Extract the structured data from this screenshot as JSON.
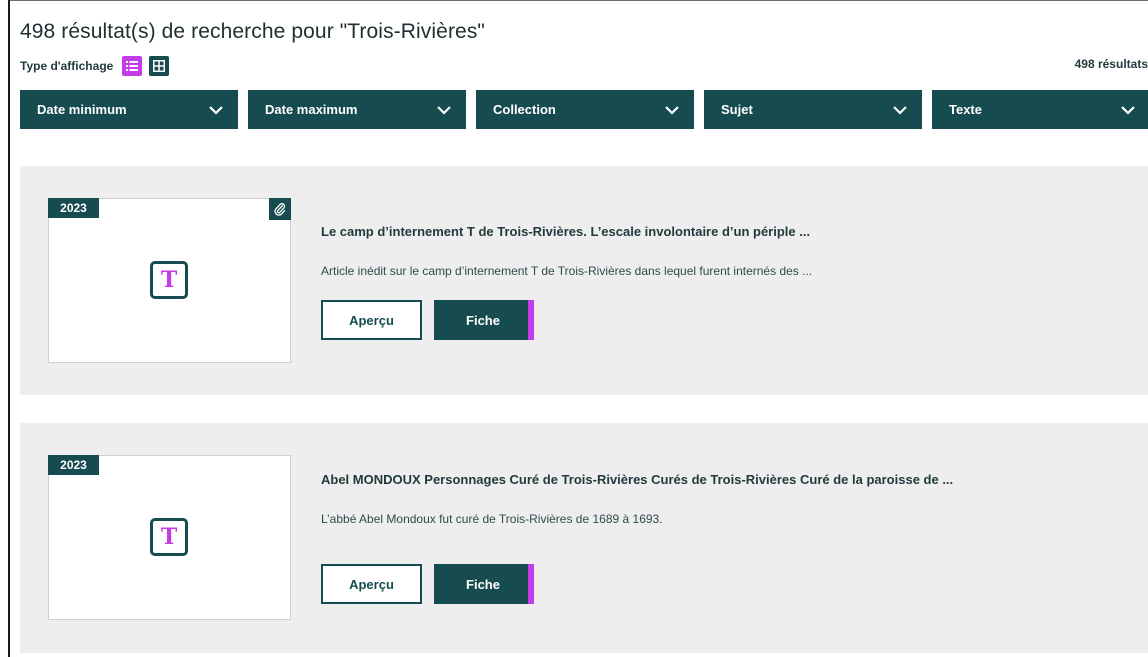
{
  "header": {
    "title": "498 résultat(s) de recherche pour \"Trois-Rivières\"",
    "view_label": "Type d'affichage",
    "results_count": "498 résultats",
    "view_modes": [
      {
        "icon": "list-view-icon",
        "active": true
      },
      {
        "icon": "grid-view-icon",
        "active": false
      }
    ]
  },
  "filters": [
    {
      "label": "Date minimum"
    },
    {
      "label": "Date maximum"
    },
    {
      "label": "Collection"
    },
    {
      "label": "Sujet"
    },
    {
      "label": "Texte"
    }
  ],
  "results": [
    {
      "year": "2023",
      "has_attachment": true,
      "thumb_letter": "T",
      "title": "Le camp d’internement T de Trois-Rivières. L’escale involontaire d’un périple ...",
      "description": "Article inédit sur le camp d’internement T de Trois-Rivières dans lequel furent internés des ...",
      "apercu_label": "Aperçu",
      "fiche_label": "Fiche"
    },
    {
      "year": "2023",
      "has_attachment": false,
      "thumb_letter": "T",
      "title": "Abel MONDOUX Personnages Curé de Trois-Rivières Curés de Trois-Rivières Curé de la paroisse de ...",
      "description": "L’abbé Abel Mondoux fut curé de Trois-Rivières de 1689 à 1693.",
      "apercu_label": "Aperçu",
      "fiche_label": "Fiche"
    }
  ],
  "colors": {
    "primary": "#164b50",
    "accent": "#c53be8",
    "card_bg": "#eeeeee"
  }
}
